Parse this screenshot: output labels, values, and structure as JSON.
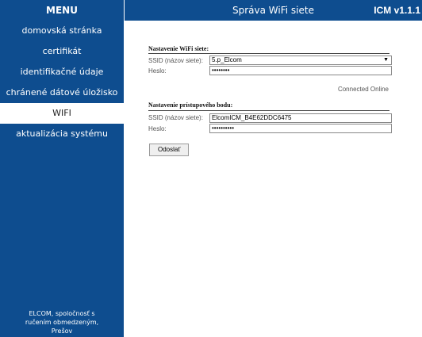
{
  "sidebar": {
    "title": "MENU",
    "items": [
      {
        "label": "domovská stránka"
      },
      {
        "label": "certifikát"
      },
      {
        "label": "identifikačné údaje"
      },
      {
        "label": "chránené dátové úložisko"
      },
      {
        "label": "WIFI"
      },
      {
        "label": "aktualizácia systému"
      }
    ],
    "footer": [
      "ELCOM, spoločnosť s",
      "ručením obmedzeným,",
      "Prešov"
    ]
  },
  "header": {
    "title": "Správa WiFi siete",
    "version": "ICM v1.1.1"
  },
  "wifi": {
    "section_title": "Nastavenie WiFi siete:",
    "ssid_label": "SSID (názov siete):",
    "ssid_value": "5.p_Elcom",
    "password_label": "Heslo:",
    "password_value": "••••••••",
    "status": "Connected Online"
  },
  "ap": {
    "section_title": "Nastavenie prístupového bodu:",
    "ssid_label": "SSID (názov siete):",
    "ssid_value": "ElcomICM_B4E62DDC6475",
    "password_label": "Heslo:",
    "password_value": "••••••••••"
  },
  "submit_label": "Odoslať",
  "colors": {
    "brand_blue": "#0e4d8f"
  }
}
